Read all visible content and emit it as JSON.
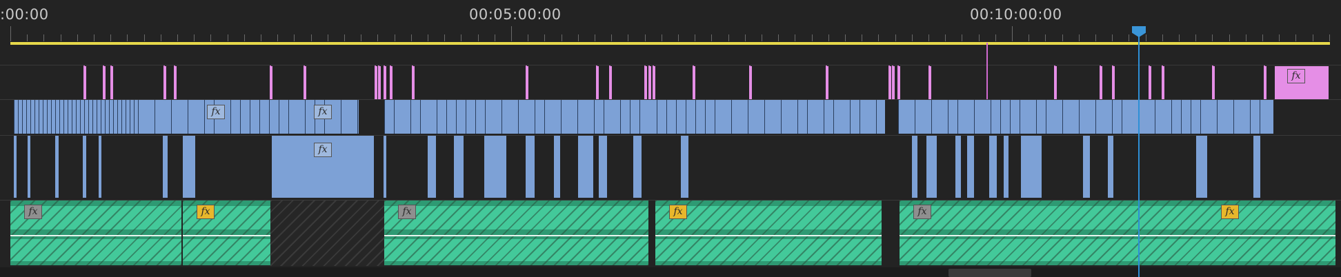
{
  "ruler": {
    "labels": [
      ":00:00",
      "00:05:00:00",
      "00:10:00:00"
    ]
  },
  "tracks": {
    "v3": {
      "fx": "fx"
    },
    "v2": {
      "fx": "fx"
    },
    "v1": {
      "fx": "fx"
    },
    "a1": {
      "fx": "fx"
    }
  },
  "colors": {
    "background": "#232323",
    "video_clip": "#7da1d6",
    "graphic_clip": "#e58ee6",
    "audio_clip": "#2e9a73",
    "work_area_bar": "#e6d84a",
    "playhead": "#2e8fd6",
    "fx_badge_yellow": "#e8b72c"
  },
  "icons": {
    "playhead": "playhead-handle-icon",
    "fx": "fx-badge-icon",
    "keyframe": "keyframe-diamond-icon"
  }
}
